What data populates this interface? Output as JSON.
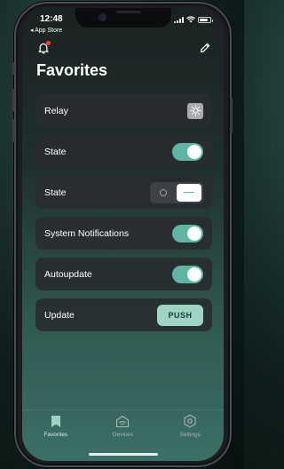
{
  "status_bar": {
    "time": "12:48",
    "back_app": "◂ App Store"
  },
  "header": {
    "title": "Favorites",
    "bell_icon": "bell-icon",
    "edit_icon": "pencil-icon"
  },
  "cards": [
    {
      "label": "Relay",
      "control": "lamp-button"
    },
    {
      "label": "State",
      "control": "toggle",
      "on": true
    },
    {
      "label": "State",
      "control": "segmented"
    },
    {
      "label": "System Notifications",
      "control": "toggle",
      "on": true
    },
    {
      "label": "Autoupdate",
      "control": "toggle",
      "on": true
    },
    {
      "label": "Update",
      "control": "button",
      "button_label": "PUSH"
    }
  ],
  "tabbar": {
    "items": [
      {
        "label": "Favorites",
        "icon": "bookmark-icon",
        "active": true
      },
      {
        "label": "Devices",
        "icon": "router-icon",
        "active": false
      },
      {
        "label": "Settings",
        "icon": "hexagon-gear-icon",
        "active": false
      }
    ]
  },
  "colors": {
    "accent": "#5fb5a3",
    "push_button": "#9fd4c4",
    "card_bg": "#282c30",
    "notification_dot": "#ff3b30"
  }
}
